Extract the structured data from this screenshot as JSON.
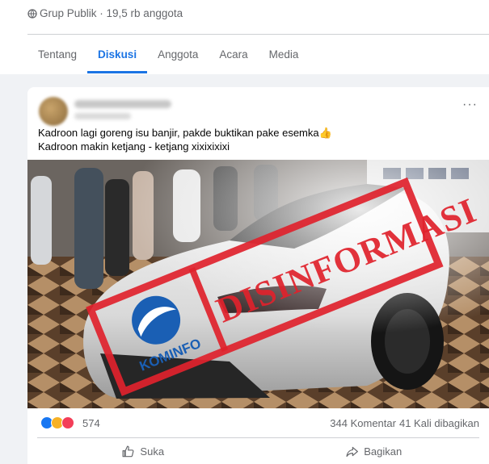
{
  "group": {
    "meta": "Grup Publik · 19,5 rb anggota"
  },
  "tabs": [
    {
      "label": "Tentang",
      "active": false
    },
    {
      "label": "Diskusi",
      "active": true
    },
    {
      "label": "Anggota",
      "active": false
    },
    {
      "label": "Acara",
      "active": false
    },
    {
      "label": "Media",
      "active": false
    }
  ],
  "post": {
    "more_label": "···",
    "text_lines": [
      "Kadroon lagi goreng isu banjir, pakde buktikan pake esemka👍",
      "Kadroon makin ketjang - ketjang xixixixixi"
    ],
    "image": {
      "stamp_text": "DISINFORMASI",
      "logo_text": "KOMINFO"
    },
    "reactions": {
      "count": "574",
      "types": [
        "like",
        "haha",
        "love"
      ]
    },
    "comments": "344 Komentar",
    "shares": "41 Kali dibagikan"
  },
  "actions": {
    "like": "Suka",
    "share": "Bagikan"
  },
  "colors": {
    "accent": "#1b74e4",
    "stamp_red": "#e0222c"
  }
}
